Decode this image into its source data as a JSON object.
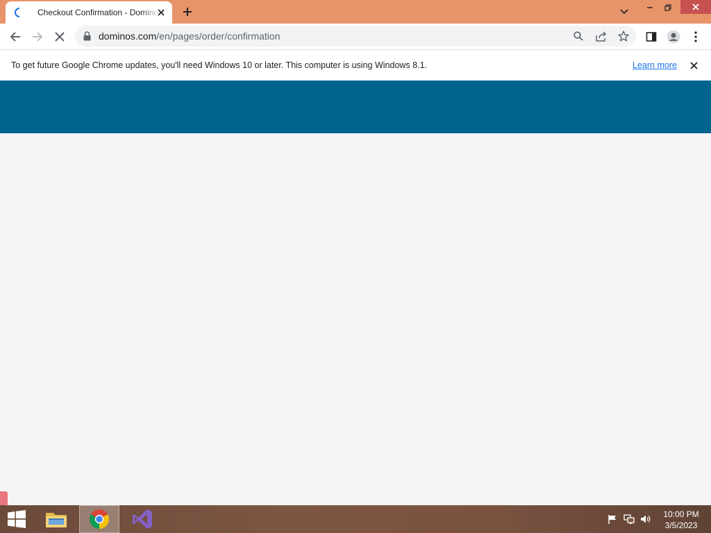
{
  "browser": {
    "tab": {
      "title": "Checkout Confirmation - Domino's"
    },
    "omnibox": {
      "host": "dominos.com",
      "path": "/en/pages/order/confirmation"
    }
  },
  "infobar": {
    "message": "To get future Google Chrome updates, you'll need Windows 10 or later. This computer is using Windows 8.1.",
    "link": "Learn more"
  },
  "page": {
    "header_color": "#006491",
    "body_color": "#f4f4f4"
  },
  "taskbar": {
    "apps": [
      "windows-start",
      "file-explorer",
      "google-chrome",
      "visual-studio"
    ],
    "clock": {
      "time": "10:00 PM",
      "date": "3/5/2023"
    }
  },
  "colors": {
    "titlebar": "#e8946a",
    "link": "#1a73e8"
  }
}
